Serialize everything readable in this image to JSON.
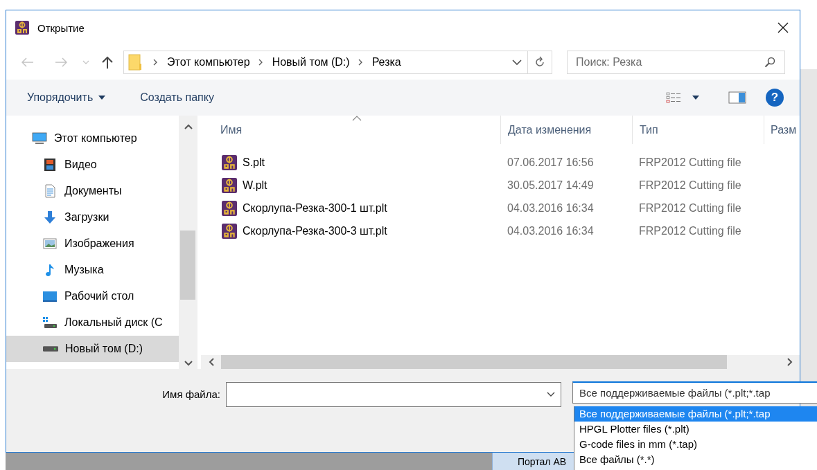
{
  "window": {
    "title": "Открытие"
  },
  "address_bar": {
    "path": [
      "Этот компьютер",
      "Новый том (D:)",
      "Резка"
    ]
  },
  "search": {
    "placeholder": "Поиск: Резка"
  },
  "toolbar": {
    "organize": "Упорядочить",
    "new_folder": "Создать папку",
    "help": "?"
  },
  "navigation": [
    {
      "label": "Этот компьютер",
      "kind": "computer",
      "selected": false,
      "children": [
        {
          "label": "Видео",
          "kind": "video",
          "selected": false
        },
        {
          "label": "Документы",
          "kind": "documents",
          "selected": false
        },
        {
          "label": "Загрузки",
          "kind": "downloads",
          "selected": false
        },
        {
          "label": "Изображения",
          "kind": "pictures",
          "selected": false
        },
        {
          "label": "Музыка",
          "kind": "music",
          "selected": false
        },
        {
          "label": "Рабочий стол",
          "kind": "desktop",
          "selected": false
        },
        {
          "label": "Локальный диск (С",
          "kind": "local-disk",
          "selected": false
        },
        {
          "label": "Новый том (D:)",
          "kind": "drive",
          "selected": true
        }
      ]
    }
  ],
  "file_list": {
    "columns": [
      {
        "label": "Имя",
        "sorted": true
      },
      {
        "label": "Дата изменения",
        "sorted": false
      },
      {
        "label": "Тип",
        "sorted": false
      },
      {
        "label": "Разм",
        "sorted": false
      }
    ],
    "rows": [
      {
        "name": "S.plt",
        "date": "07.06.2017 16:56",
        "type": "FRP2012 Cutting file"
      },
      {
        "name": "W.plt",
        "date": "30.05.2017 14:49",
        "type": "FRP2012 Cutting file"
      },
      {
        "name": "Скорлупа-Резка-300-1 шт.plt",
        "date": "04.03.2016 16:34",
        "type": "FRP2012 Cutting file"
      },
      {
        "name": "Скорлупа-Резка-300-3 шт.plt",
        "date": "04.03.2016 16:34",
        "type": "FRP2012 Cutting file"
      }
    ]
  },
  "file_name": {
    "label": "Имя файла:"
  },
  "file_type": {
    "value": "Все поддерживаемые файлы (*.plt;*.tap",
    "options": [
      {
        "label": "Все поддерживаемые файлы (*.plt;*.tap",
        "selected": true
      },
      {
        "label": "HPGL Plotter files (*.plt)",
        "selected": false
      },
      {
        "label": "G-code files in mm (*.tap)",
        "selected": false
      },
      {
        "label": "Все файлы (*.*)",
        "selected": false
      }
    ]
  },
  "background": {
    "label": "Портал АВ"
  }
}
